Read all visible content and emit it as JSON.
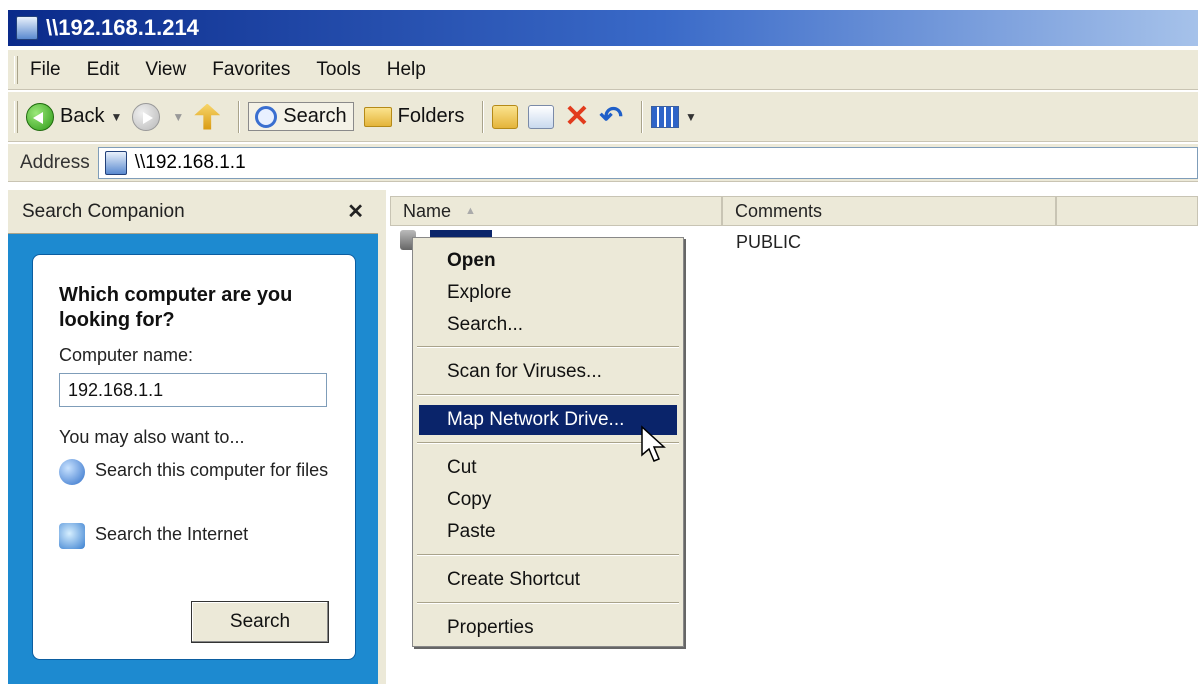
{
  "window": {
    "title": "\\\\192.168.1.214"
  },
  "menu": [
    "File",
    "Edit",
    "View",
    "Favorites",
    "Tools",
    "Help"
  ],
  "toolbar": {
    "back_label": "Back",
    "search_label": "Search",
    "folders_label": "Folders"
  },
  "address": {
    "label": "Address",
    "value": "\\\\192.168.1.1"
  },
  "search_companion": {
    "title": "Search Companion",
    "close_glyph": "✕",
    "question": "Which computer are you looking for?",
    "computer_name_label": "Computer name:",
    "computer_name_value": "192.168.1.1",
    "also_label": "You may also want to...",
    "option1": "Search this computer for files",
    "option2": "Search the Internet",
    "search_button": "Search"
  },
  "file_list": {
    "columns": [
      "Name",
      "Comments"
    ],
    "rows": [
      {
        "comment": "PUBLIC"
      }
    ]
  },
  "context_menu": {
    "items": [
      "Open",
      "Explore",
      "Search...",
      "Scan for Viruses...",
      "Map Network Drive...",
      "Cut",
      "Copy",
      "Paste",
      "Create Shortcut",
      "Properties"
    ]
  },
  "colors": {
    "title_start": "#0a2a8a",
    "highlight": "#0a246a",
    "pane_blue": "#1d8ad0"
  }
}
